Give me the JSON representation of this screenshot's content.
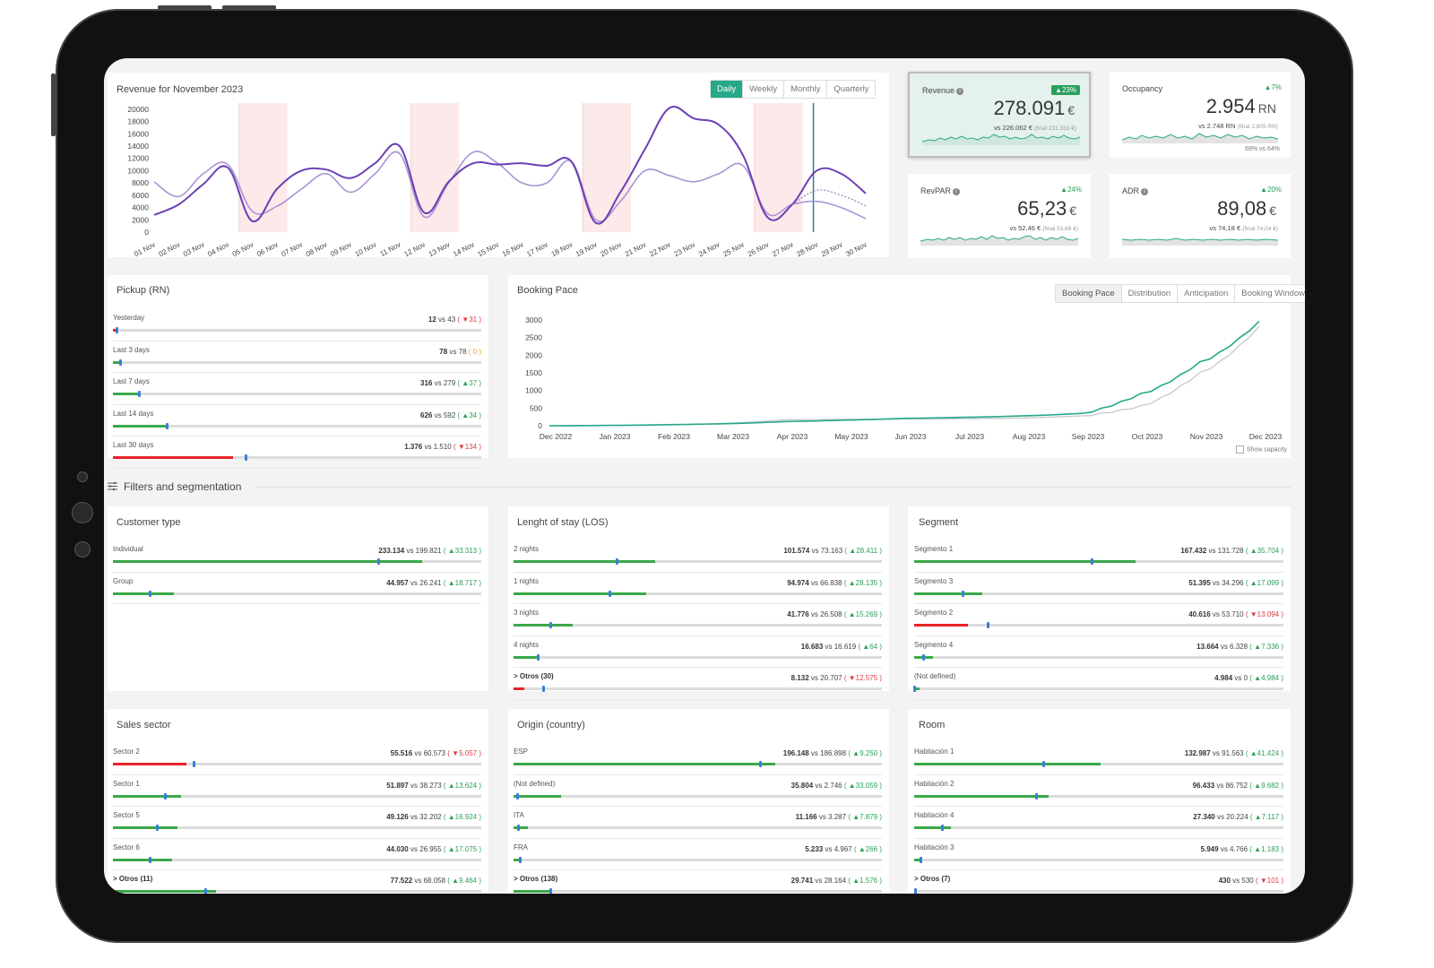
{
  "revenue_chart": {
    "title": "Revenue for November 2023",
    "tabs": [
      "Daily",
      "Weekly",
      "Monthly",
      "Quarterly"
    ],
    "active_tab": "Daily",
    "chart_data": {
      "type": "line",
      "x": [
        "01 Nov",
        "02 Nov",
        "03 Nov",
        "04 Nov",
        "05 Nov",
        "06 Nov",
        "07 Nov",
        "08 Nov",
        "09 Nov",
        "10 Nov",
        "11 Nov",
        "12 Nov",
        "13 Nov",
        "14 Nov",
        "15 Nov",
        "16 Nov",
        "17 Nov",
        "18 Nov",
        "19 Nov",
        "20 Nov",
        "21 Nov",
        "22 Nov",
        "23 Nov",
        "24 Nov",
        "25 Nov",
        "26 Nov",
        "27 Nov",
        "28 Nov",
        "29 Nov",
        "30 Nov"
      ],
      "yticks": [
        0,
        2000,
        4000,
        6000,
        8000,
        10000,
        12000,
        14000,
        16000,
        18000,
        20000
      ],
      "ylim": [
        0,
        21000
      ],
      "series": [
        {
          "values": [
            2800,
            4500,
            7800,
            10500,
            1800,
            7000,
            10000,
            10200,
            8800,
            11200,
            14000,
            3200,
            8200,
            11200,
            11000,
            11200,
            10800,
            11500,
            1500,
            6500,
            13500,
            20200,
            18500,
            17500,
            12500,
            2400,
            4500,
            10000,
            9500,
            6300
          ],
          "color": "#6c3fb5"
        },
        {
          "values": [
            8200,
            5800,
            9500,
            11000,
            3400,
            4200,
            7000,
            9500,
            6500,
            9500,
            12800,
            2500,
            8000,
            13000,
            11200,
            8000,
            8000,
            11500,
            2000,
            5000,
            10000,
            9200,
            8200,
            9500,
            10800,
            3000,
            4500,
            5000,
            4000,
            2200
          ],
          "color": "#a894d6"
        }
      ],
      "forecast_values": [
        4500,
        6800,
        6000,
        4300
      ],
      "weekend_bands": [
        [
          4,
          5
        ],
        [
          11,
          12
        ],
        [
          18,
          19
        ],
        [
          25,
          26
        ]
      ],
      "today_index": 27
    }
  },
  "kpis": {
    "revenue": {
      "label": "Revenue",
      "badge": "▲23%",
      "value": "278.091",
      "unit": "€",
      "vs": "vs 226.062 €",
      "final": "(final 231.333 €)"
    },
    "occupancy": {
      "label": "Occupancy",
      "badge": "▲7%",
      "value": "2.954",
      "unit": "RN",
      "vs": "vs 2.748 RN",
      "final": "(final 2.805 RN)",
      "occ": "69% vs 64%"
    },
    "revpar": {
      "label": "RevPAR",
      "badge": "▲24%",
      "value": "65,23",
      "unit": "€",
      "vs": "vs 52,46 €",
      "final": "(final 53,69 €)"
    },
    "adr": {
      "label": "ADR",
      "badge": "▲20%",
      "value": "89,08",
      "unit": "€",
      "vs": "vs 74,18 €",
      "final": "(final 74,04 €)"
    }
  },
  "pickup": {
    "title": "Pickup (RN)",
    "rows": [
      {
        "label": "Yesterday",
        "value": "12",
        "vs": "vs 43",
        "delta": "( ▼31 )",
        "trend": "down",
        "fill": 0.01,
        "marker": 0.01
      },
      {
        "label": "Last 3 days",
        "value": "78",
        "vs": "vs 78",
        "delta": "( 0 )",
        "trend": "neutral",
        "fill": 0.02,
        "marker": 0.02
      },
      {
        "label": "Last 7 days",
        "value": "316",
        "vs": "vs 279",
        "delta": "( ▲37 )",
        "trend": "up",
        "fill": 0.07,
        "marker": 0.07
      },
      {
        "label": "Last 14 days",
        "value": "626",
        "vs": "vs 592",
        "delta": "( ▲34 )",
        "trend": "up",
        "fill": 0.145,
        "marker": 0.145
      },
      {
        "label": "Last 30 days",
        "value": "1.376",
        "vs": "vs 1.510",
        "delta": "( ▼134 )",
        "trend": "down",
        "fill": 0.325,
        "marker": 0.36
      }
    ]
  },
  "booking_pace": {
    "title": "Booking Pace",
    "tabs": [
      "Booking Pace",
      "Distribution",
      "Anticipation",
      "Booking Window"
    ],
    "active_tab": "Booking Pace",
    "show_capacity": "Show capacity",
    "chart_data": {
      "type": "line",
      "x": [
        "Dec 2022",
        "Jan 2023",
        "Feb 2023",
        "Mar 2023",
        "Apr 2023",
        "May 2023",
        "Jun 2023",
        "Jul 2023",
        "Aug 2023",
        "Sep 2023",
        "Oct 2023",
        "Nov 2023",
        "Dec 2023"
      ],
      "yticks": [
        0,
        500,
        1000,
        1500,
        2000,
        2500,
        3000
      ],
      "ylim": [
        0,
        3000
      ],
      "series": [
        {
          "values": [
            0,
            10,
            30,
            60,
            120,
            160,
            210,
            240,
            280,
            350,
            900,
            1800,
            2950
          ],
          "color": "#26a88a"
        },
        {
          "values": [
            0,
            5,
            25,
            70,
            170,
            180,
            190,
            200,
            220,
            280,
            550,
            1500,
            2800
          ],
          "color": "#c8c8c8"
        }
      ]
    }
  },
  "filters": {
    "title": "Filters and segmentation"
  },
  "panels": {
    "customer_type": {
      "title": "Customer type",
      "rows": [
        {
          "label": "Individual",
          "value": "233.134",
          "vs": "vs 199.821",
          "delta": "( ▲33.313 )",
          "trend": "up",
          "fill": 0.84,
          "marker": 0.72
        },
        {
          "label": "Group",
          "value": "44.957",
          "vs": "vs 26.241",
          "delta": "( ▲18.717 )",
          "trend": "up",
          "fill": 0.165,
          "marker": 0.1
        }
      ]
    },
    "los": {
      "title": "Lenght of stay (LOS)",
      "rows": [
        {
          "label": "2 nights",
          "value": "101.574",
          "vs": "vs 73.163",
          "delta": "( ▲28.411 )",
          "trend": "up",
          "fill": 0.385,
          "marker": 0.28
        },
        {
          "label": "1 nights",
          "value": "94.974",
          "vs": "vs 66.838",
          "delta": "( ▲28.135 )",
          "trend": "up",
          "fill": 0.36,
          "marker": 0.26
        },
        {
          "label": "3 nights",
          "value": "41.776",
          "vs": "vs 26.508",
          "delta": "( ▲15.269 )",
          "trend": "up",
          "fill": 0.16,
          "marker": 0.1
        },
        {
          "label": "4 nights",
          "value": "16.683",
          "vs": "vs 16.619",
          "delta": "( ▲64 )",
          "trend": "up",
          "fill": 0.065,
          "marker": 0.065
        },
        {
          "label": "> Otros (30)",
          "value": "8.132",
          "vs": "vs 20.707",
          "delta": "( ▼12.575 )",
          "trend": "down",
          "fill": 0.03,
          "marker": 0.08,
          "bold": true
        }
      ]
    },
    "segment": {
      "title": "Segment",
      "rows": [
        {
          "label": "Segmento 1",
          "value": "167.432",
          "vs": "vs 131.728",
          "delta": "( ▲35.704 )",
          "trend": "up",
          "fill": 0.6,
          "marker": 0.48
        },
        {
          "label": "Segmento 3",
          "value": "51.395",
          "vs": "vs 34.296",
          "delta": "( ▲17.099 )",
          "trend": "up",
          "fill": 0.185,
          "marker": 0.13
        },
        {
          "label": "Segmento 2",
          "value": "40.616",
          "vs": "vs 53.710",
          "delta": "( ▼13.094 )",
          "trend": "down",
          "fill": 0.145,
          "marker": 0.2
        },
        {
          "label": "Segmento 4",
          "value": "13.664",
          "vs": "vs 6.328",
          "delta": "( ▲7.336 )",
          "trend": "up",
          "fill": 0.05,
          "marker": 0.025
        },
        {
          "label": "(Not defined)",
          "value": "4.984",
          "vs": "vs 0",
          "delta": "( ▲4.984 )",
          "trend": "up",
          "fill": 0.015,
          "marker": 0.0
        }
      ]
    },
    "sales_sector": {
      "title": "Sales sector",
      "rows": [
        {
          "label": "Sector 2",
          "value": "55.516",
          "vs": "vs 60.573",
          "delta": "( ▼5.057 )",
          "trend": "down",
          "fill": 0.2,
          "marker": 0.22
        },
        {
          "label": "Sector 1",
          "value": "51.897",
          "vs": "vs 38.273",
          "delta": "( ▲13.624 )",
          "trend": "up",
          "fill": 0.185,
          "marker": 0.14
        },
        {
          "label": "Sector 5",
          "value": "49.126",
          "vs": "vs 32.202",
          "delta": "( ▲16.924 )",
          "trend": "up",
          "fill": 0.175,
          "marker": 0.12
        },
        {
          "label": "Sector 6",
          "value": "44.030",
          "vs": "vs 26.955",
          "delta": "( ▲17.075 )",
          "trend": "up",
          "fill": 0.16,
          "marker": 0.1
        },
        {
          "label": "> Otros (11)",
          "value": "77.522",
          "vs": "vs 68.058",
          "delta": "( ▲9.464 )",
          "trend": "up",
          "fill": 0.28,
          "marker": 0.25,
          "bold": true
        }
      ]
    },
    "origin": {
      "title": "Origin (country)",
      "rows": [
        {
          "label": "ESP",
          "value": "196.148",
          "vs": "vs 186.898",
          "delta": "( ▲9.250 )",
          "trend": "up",
          "fill": 0.71,
          "marker": 0.67
        },
        {
          "label": "(Not defined)",
          "value": "35.804",
          "vs": "vs 2.746",
          "delta": "( ▲33.059 )",
          "trend": "up",
          "fill": 0.13,
          "marker": 0.01
        },
        {
          "label": "ITA",
          "value": "11.166",
          "vs": "vs 3.287",
          "delta": "( ▲7.879 )",
          "trend": "up",
          "fill": 0.04,
          "marker": 0.012
        },
        {
          "label": "FRA",
          "value": "5.233",
          "vs": "vs 4.967",
          "delta": "( ▲266 )",
          "trend": "up",
          "fill": 0.02,
          "marker": 0.018
        },
        {
          "label": "> Otros (138)",
          "value": "29.741",
          "vs": "vs 28.164",
          "delta": "( ▲1.576 )",
          "trend": "up",
          "fill": 0.105,
          "marker": 0.1,
          "bold": true
        }
      ]
    },
    "room": {
      "title": "Room",
      "rows": [
        {
          "label": "Habitación 1",
          "value": "132.987",
          "vs": "vs 91.563",
          "delta": "( ▲41.424 )",
          "trend": "up",
          "fill": 0.505,
          "marker": 0.35
        },
        {
          "label": "Habitación 2",
          "value": "96.433",
          "vs": "vs 86.752",
          "delta": "( ▲9.682 )",
          "trend": "up",
          "fill": 0.365,
          "marker": 0.33
        },
        {
          "label": "Habitación 4",
          "value": "27.340",
          "vs": "vs 20.224",
          "delta": "( ▲7.117 )",
          "trend": "up",
          "fill": 0.1,
          "marker": 0.075
        },
        {
          "label": "Habitación 3",
          "value": "5.949",
          "vs": "vs 4.766",
          "delta": "( ▲1.183 )",
          "trend": "up",
          "fill": 0.022,
          "marker": 0.018
        },
        {
          "label": "> Otros (7)",
          "value": "430",
          "vs": "vs 530",
          "delta": "( ▼101 )",
          "trend": "down",
          "fill": 0.002,
          "marker": 0.002,
          "bold": true
        }
      ]
    }
  },
  "colors": {
    "up": "#3aa84a",
    "down": "#e8232a",
    "neutral": "#f0a030",
    "accent": "#26a88a",
    "purple": "#6c3fb5",
    "lavender": "#a894d6",
    "marker": "#3b7fd9",
    "weekend": "#fce9e9"
  }
}
